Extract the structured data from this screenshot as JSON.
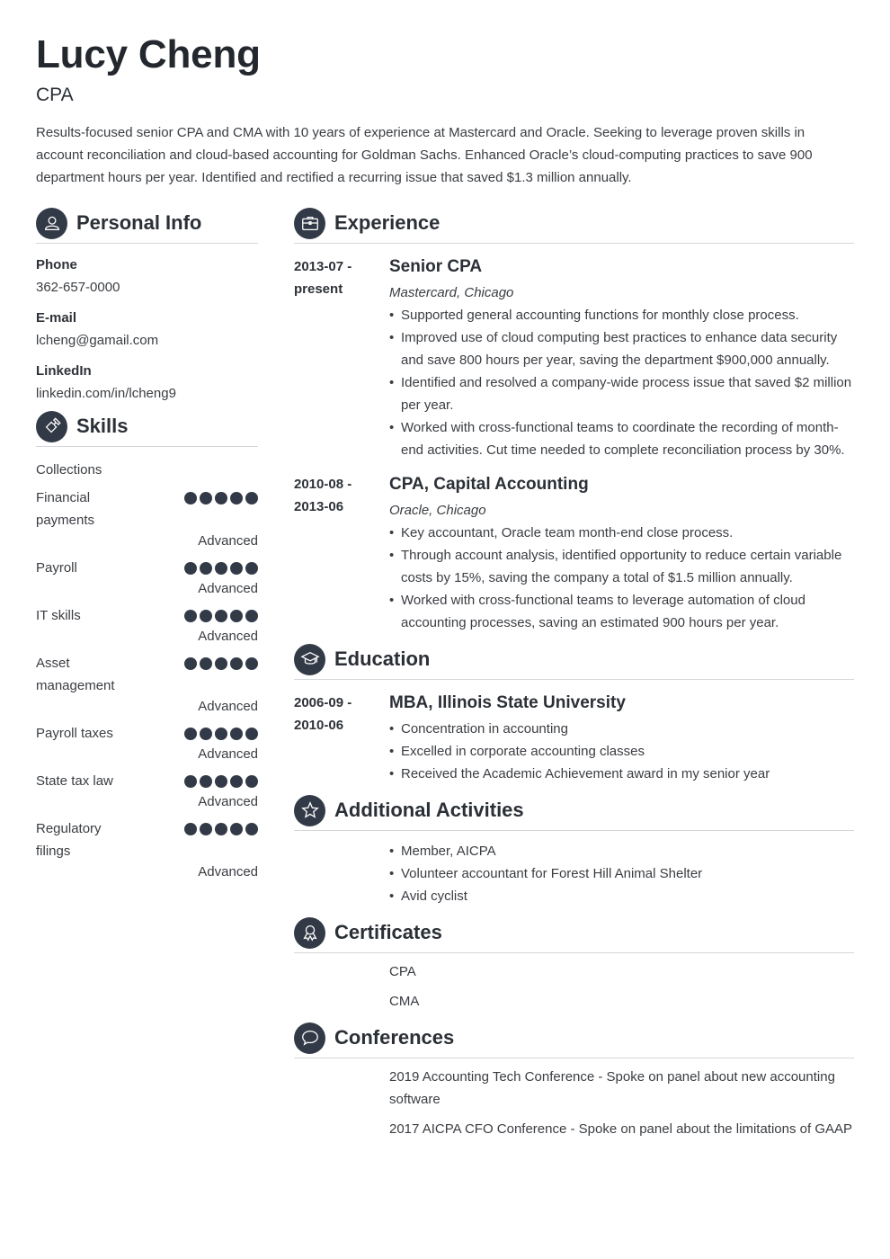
{
  "header": {
    "name": "Lucy Cheng",
    "title": "CPA",
    "summary": "Results-focused senior CPA and CMA with 10 years of experience at Mastercard and Oracle. Seeking to leverage proven skills in account reconciliation and cloud-based accounting for Goldman Sachs. Enhanced Oracle’s cloud-computing practices to save 900 department hours per year. Identified and rectified a recurring issue that saved $1.3 million annually."
  },
  "personal_info": {
    "heading": "Personal Info",
    "icon": "user-icon",
    "fields": [
      {
        "label": "Phone",
        "value": "362-657-0000"
      },
      {
        "label": "E-mail",
        "value": "lcheng@gamail.com"
      },
      {
        "label": "LinkedIn",
        "value": "linkedin.com/in/lcheng9"
      }
    ]
  },
  "skills": {
    "heading": "Skills",
    "icon": "puzzle-icon",
    "plain": "Collections",
    "items": [
      {
        "name": "Financial payments",
        "level": "Advanced",
        "rating": 5,
        "max": 5
      },
      {
        "name": "Payroll",
        "level": "Advanced",
        "rating": 5,
        "max": 5
      },
      {
        "name": "IT skills",
        "level": "Advanced",
        "rating": 5,
        "max": 5
      },
      {
        "name": "Asset management",
        "level": "Advanced",
        "rating": 5,
        "max": 5
      },
      {
        "name": "Payroll taxes",
        "level": "Advanced",
        "rating": 5,
        "max": 5
      },
      {
        "name": "State tax law",
        "level": "Advanced",
        "rating": 5,
        "max": 5
      },
      {
        "name": "Regulatory filings",
        "level": "Advanced",
        "rating": 5,
        "max": 5
      }
    ]
  },
  "experience": {
    "heading": "Experience",
    "icon": "briefcase-icon",
    "entries": [
      {
        "date_start": "2013-07 -",
        "date_end": "present",
        "title": "Senior CPA",
        "company": "Mastercard, Chicago",
        "bullets": [
          "Supported general accounting functions for monthly close process.",
          "Improved use of cloud computing best practices to enhance data security and save 800 hours per year, saving the department $900,000 annually.",
          "Identified and resolved a company-wide process issue that saved $2 million per year.",
          "Worked with cross-functional teams to coordinate the recording of month-end activities. Cut time needed to complete reconciliation process by 30%."
        ]
      },
      {
        "date_start": "2010-08 -",
        "date_end": "2013-06",
        "title": "CPA, Capital Accounting",
        "company": "Oracle, Chicago",
        "bullets": [
          "Key accountant, Oracle team month-end close process.",
          "Through account analysis, identified opportunity to reduce certain variable costs by 15%, saving the company a total of $1.5 million annually.",
          "Worked with cross-functional teams to leverage automation of cloud accounting processes, saving an estimated 900 hours per year."
        ]
      }
    ]
  },
  "education": {
    "heading": "Education",
    "icon": "graduation-cap-icon",
    "entries": [
      {
        "date_start": "2006-09 -",
        "date_end": "2010-06",
        "title": "MBA, Illinois State University",
        "bullets": [
          "Concentration in accounting",
          "Excelled in corporate accounting classes",
          "Received the Academic Achievement award in my senior year"
        ]
      }
    ]
  },
  "activities": {
    "heading": "Additional Activities",
    "icon": "star-icon",
    "bullets": [
      "Member, AICPA",
      "Volunteer accountant for Forest Hill Animal Shelter",
      "Avid cyclist"
    ]
  },
  "certificates": {
    "heading": "Certificates",
    "icon": "award-ribbon-icon",
    "items": [
      "CPA",
      "CMA"
    ]
  },
  "conferences": {
    "heading": "Conferences",
    "icon": "speech-bubble-icon",
    "items": [
      "2019 Accounting Tech Conference - Spoke on panel about new accounting software",
      "2017 AICPA CFO Conference - Spoke on panel about the limitations of GAAP"
    ]
  }
}
